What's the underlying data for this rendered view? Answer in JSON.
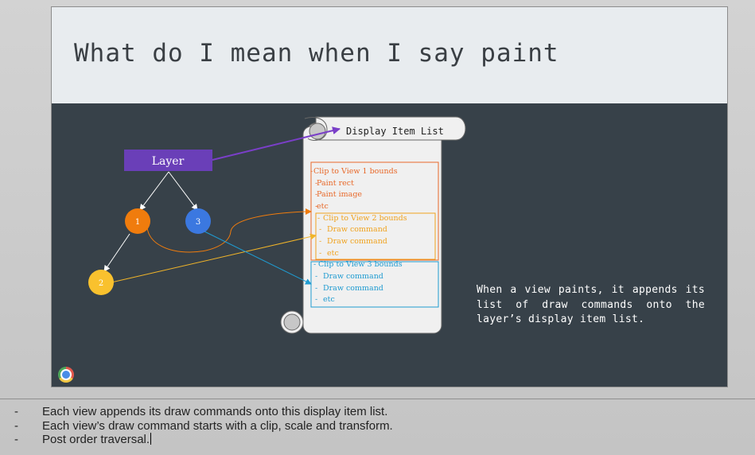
{
  "slide": {
    "title": "What do I mean when I say paint",
    "diagram": {
      "layer_label": "Layer",
      "nodes": [
        {
          "label": "1",
          "color": "#f07c0d"
        },
        {
          "label": "3",
          "color": "#3b78e0"
        },
        {
          "label": "2",
          "color": "#f9c12e"
        }
      ],
      "scroll_title": "Display Item List",
      "groups": [
        {
          "color": "#e8692a",
          "items": [
            "Clip to View 1 bounds",
            "Paint rect",
            "Paint image",
            "etc"
          ]
        },
        {
          "color": "#f0a21e",
          "items": [
            "Clip to View 2 bounds",
            "Draw command",
            "Draw command",
            "etc"
          ]
        },
        {
          "color": "#1f9bd1",
          "items": [
            "Clip to View 3 bounds",
            "Draw command",
            "Draw command",
            "etc"
          ]
        }
      ],
      "layer_color": "#6a3fb8"
    },
    "explanation": "When a view paints, it appends its list of draw commands onto the layer’s display item list."
  },
  "notes": [
    "Each view appends its draw commands onto this display item list.",
    "Each view’s draw command starts with a clip, scale and transform.",
    "Post order traversal."
  ]
}
